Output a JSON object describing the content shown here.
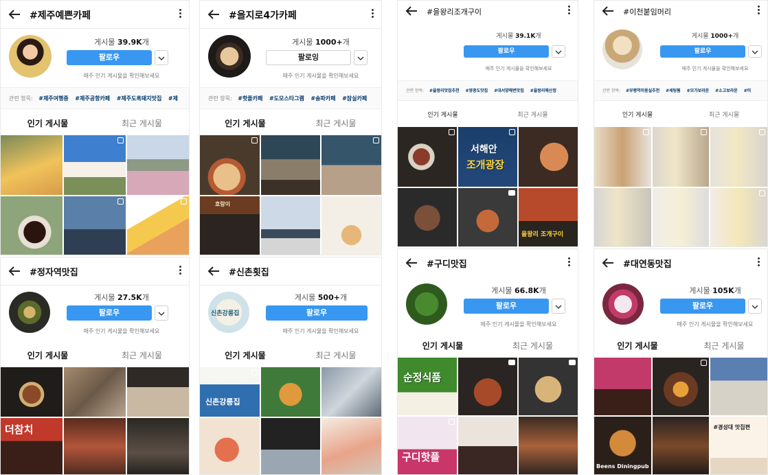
{
  "panels": [
    {
      "id": "p1",
      "back": "back-arrow-icon",
      "title": "#제주예쁜카페",
      "count_label": "게시물 ",
      "count_value": "39.9K",
      "count_suffix": "개",
      "follow": "팔로우",
      "hint": "매주 인기 게시물을 확인해보세요",
      "related_label": "관련 항목:",
      "related": [
        "#제주여행중",
        "#제주공항카페",
        "#제주도흑돼지맛집",
        "#제"
      ],
      "tab_top": "인기 게시물",
      "tab_recent": "최근 게시물",
      "overlays": []
    },
    {
      "id": "p2",
      "back": "back-arrow-icon",
      "title": "#을지로4가카페",
      "count_label": "게시물 ",
      "count_value": "1000+",
      "count_suffix": "개",
      "follow": "팔로잉",
      "hint": "매주 인기 게시물을 확인해보세요",
      "related_label": "관련 항목:",
      "related": [
        "#핫플카페",
        "#도모스타그램",
        "#송파카페",
        "#잠실카페"
      ],
      "tab_top": "인기 게시물",
      "tab_recent": "최근 게시물",
      "overlays": [
        "호랑이"
      ]
    },
    {
      "id": "p3",
      "back": "back-arrow-icon",
      "title": "#을왕리조개구이",
      "count_label": "게시물 ",
      "count_value": "39.1K",
      "count_suffix": "개",
      "follow": "팔로우",
      "hint": "매주 인기 게시물을 확인해보세요",
      "related_label": "관련 항목:",
      "related": [
        "#을왕리맛집추천",
        "#영종도맛집",
        "#대서양해변맛집",
        "#을왕리해산정"
      ],
      "tab_top": "인기 게시물",
      "tab_recent": "최근 게시물",
      "overlays": [
        "서해안",
        "조개광장",
        "을왕리 조개구이"
      ]
    },
    {
      "id": "p4",
      "back": "back-arrow-icon",
      "title": "#이천붙임머리",
      "count_label": "게시물 ",
      "count_value": "1000+",
      "count_suffix": "개",
      "follow": "팔로우",
      "hint": "매주 인기 게시물을 확인해보세요",
      "related_label": "관련 항목:",
      "related": [
        "#부평역미용실추천",
        "#세팅펌",
        "#모가보라운",
        "#소고보라운",
        "#미"
      ],
      "tab_top": "인기 게시물",
      "tab_recent": "최근 게시물",
      "overlays": []
    },
    {
      "id": "p5",
      "back": "back-arrow-icon",
      "title": "#정자역맛집",
      "count_label": "게시물 ",
      "count_value": "27.5K",
      "count_suffix": "개",
      "follow": "팔로우",
      "hint": "매주 인기 게시물을 확인해보세요",
      "tab_top": "인기 게시물",
      "tab_recent": "최근 게시물",
      "overlays": [
        "더참치"
      ]
    },
    {
      "id": "p6",
      "back": "back-arrow-icon",
      "title": "#신촌횟집",
      "count_label": "게시물 ",
      "count_value": "500+",
      "count_suffix": "개",
      "follow": "팔로우",
      "hint": "매주 인기 게시물을 확인해보세요",
      "tab_top": "인기 게시물",
      "tab_recent": "최근 게시물",
      "overlays": [
        "신촌강릉집",
        "신촌강릉집"
      ]
    },
    {
      "id": "p7",
      "back": "back-arrow-icon",
      "title": "#구디맛집",
      "count_label": "게시물 ",
      "count_value": "66.8K",
      "count_suffix": "개",
      "follow": "팔로우",
      "hint": "매주 인기 게시물을 확인해보세요",
      "tab_top": "인기 게시물",
      "tab_recent": "최근 게시물",
      "overlays": [
        "순정식품",
        "구디핫플"
      ]
    },
    {
      "id": "p8",
      "back": "back-arrow-icon",
      "title": "#대연동맛집",
      "count_label": "게시물 ",
      "count_value": "105K",
      "count_suffix": "개",
      "follow": "팔로우",
      "hint": "매주 인기 게시물을 확인해보세요",
      "tab_top": "인기 게시물",
      "tab_recent": "최근 게시물",
      "overlays": [
        "#경성대 맛집편",
        "Beens Diningpub"
      ]
    }
  ],
  "colors": {
    "accent": "#3897f0",
    "link": "#00376b"
  }
}
